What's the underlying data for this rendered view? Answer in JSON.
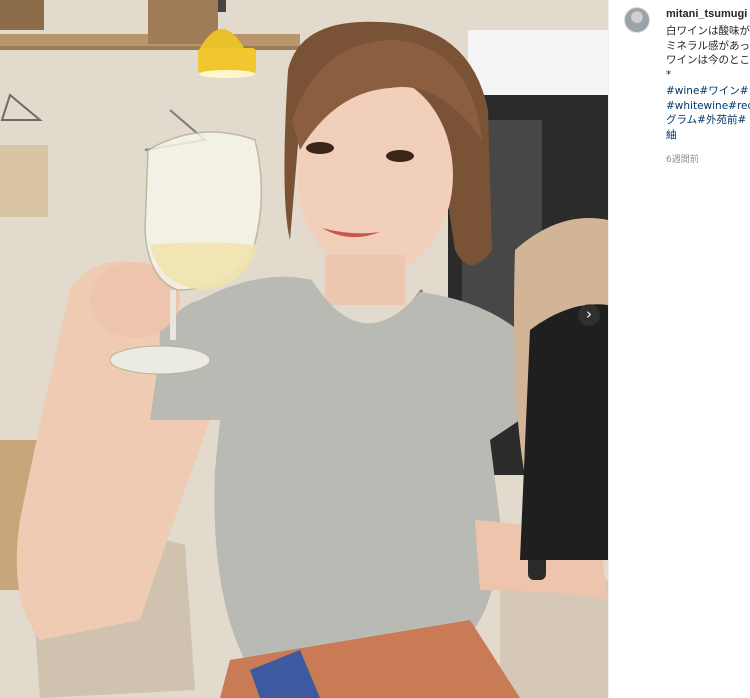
{
  "post": {
    "username": "mitani_tsumugi",
    "caption_lines": [
      "白ワインは酸味が",
      "ミネラル感があっ",
      "ワインは今のとこ",
      "*"
    ],
    "hashtag_lines": [
      "#wine#ワイン#ワ",
      "#whitewine#redw",
      "グラム#外苑前#",
      "紬"
    ],
    "timestamp": "6週間前"
  },
  "controls": {
    "next_icon": "›"
  },
  "colors": {
    "hashtag": "#00376b",
    "text": "#262626",
    "muted": "#8e8e8e"
  }
}
